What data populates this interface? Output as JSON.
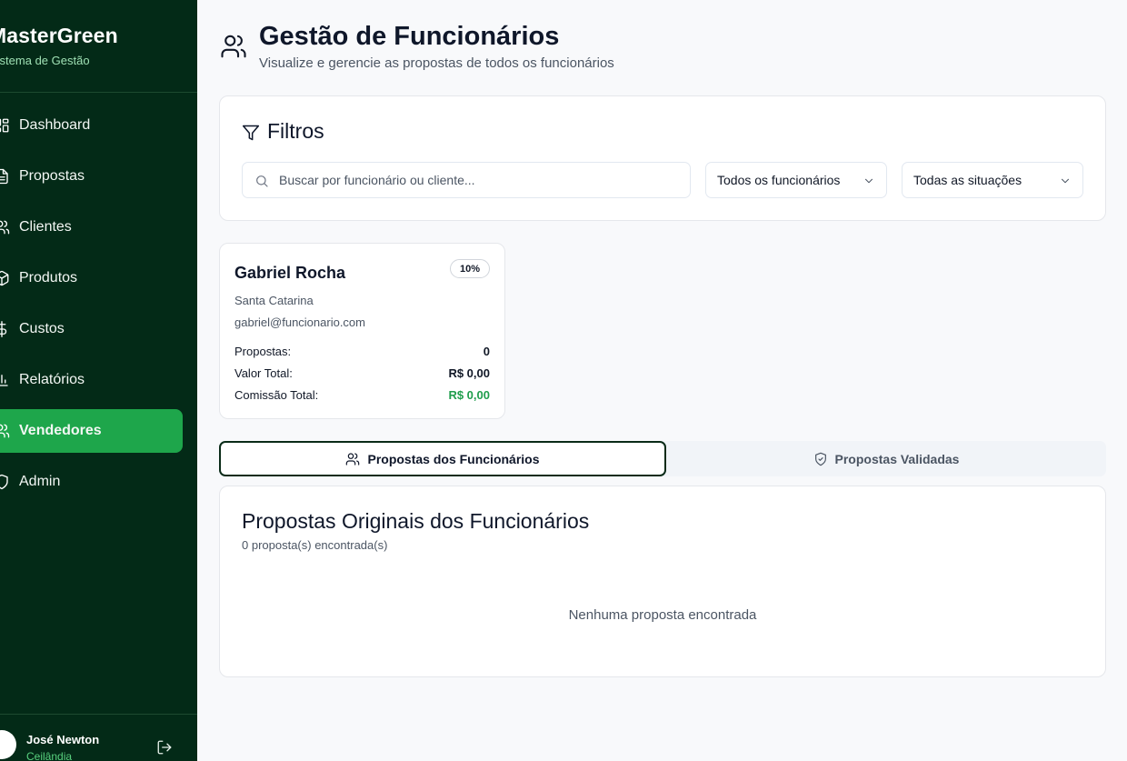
{
  "brand": {
    "name": "MasterGreen",
    "subtitle": "Sistema de Gestão"
  },
  "sidebar": {
    "items": [
      {
        "label": "Dashboard",
        "icon": "dashboard-icon",
        "active": false
      },
      {
        "label": "Propostas",
        "icon": "file-icon",
        "active": false
      },
      {
        "label": "Clientes",
        "icon": "users-icon",
        "active": false
      },
      {
        "label": "Produtos",
        "icon": "package-icon",
        "active": false
      },
      {
        "label": "Custos",
        "icon": "dollar-icon",
        "active": false
      },
      {
        "label": "Relatórios",
        "icon": "bar-chart-icon",
        "active": false
      },
      {
        "label": "Vendedores",
        "icon": "users-icon",
        "active": true
      },
      {
        "label": "Admin",
        "icon": "shield-icon",
        "active": false
      }
    ]
  },
  "user": {
    "name": "José Newton",
    "city": "Ceilândia"
  },
  "header": {
    "title": "Gestão de Funcionários",
    "subtitle": "Visualize e gerencie as propostas de todos os funcionários"
  },
  "filters": {
    "title": "Filtros",
    "search_placeholder": "Buscar por funcionário ou cliente...",
    "search_value": "",
    "employee_select": "Todos os funcionários",
    "status_select": "Todas as situações"
  },
  "employee": {
    "name": "Gabriel Rocha",
    "commission_badge": "10%",
    "region": "Santa Catarina",
    "email": "gabriel@funcionario.com",
    "proposals_label": "Propostas:",
    "proposals_value": "0",
    "total_label": "Valor Total:",
    "total_value": "R$ 0,00",
    "commission_label": "Comissão Total:",
    "commission_value": "R$ 0,00"
  },
  "tabs": [
    {
      "label": "Propostas dos Funcionários",
      "active": true
    },
    {
      "label": "Propostas Validadas",
      "active": false
    }
  ],
  "list": {
    "title": "Propostas Originais dos Funcionários",
    "count": "0 proposta(s) encontrada(s)",
    "empty": "Nenhuma proposta encontrada"
  },
  "colors": {
    "sidebar_bg": "#032a17",
    "accent": "#1ea64b",
    "commission_green": "#1f9d4c"
  }
}
